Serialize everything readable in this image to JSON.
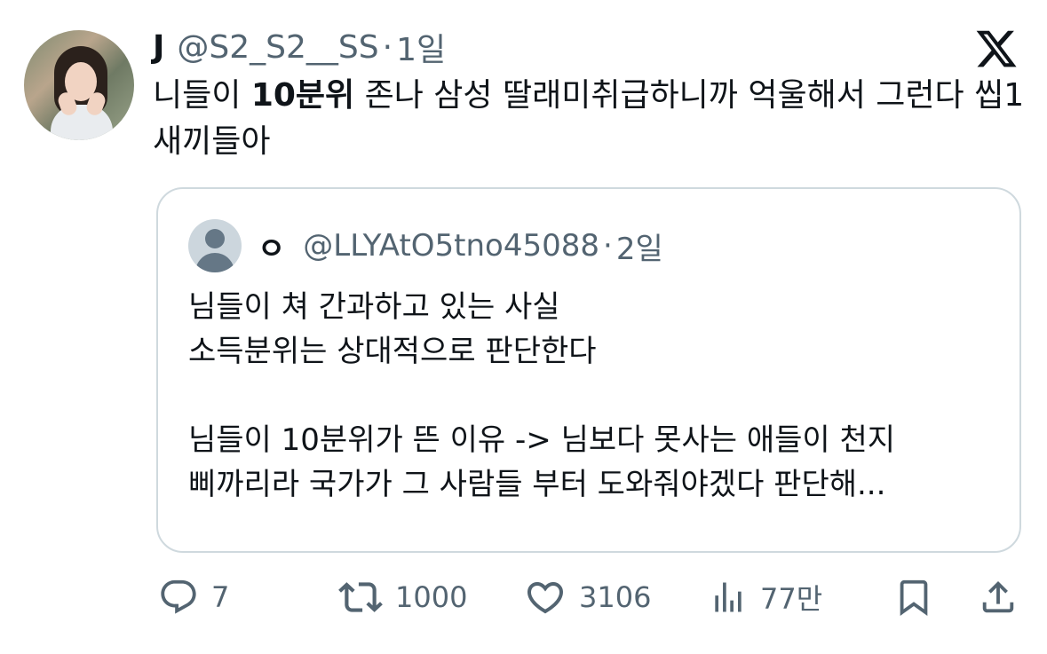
{
  "tweet": {
    "display_name": "J",
    "handle": "@S2_S2__SS",
    "separator": "·",
    "time": "1일",
    "text_part1": "니들이 ",
    "text_bold": "10분위",
    "text_part2": " 존나 삼성 딸래미취급하니까 억울해서 그런다 씹1새끼들아"
  },
  "quote": {
    "display_name": "ㅇ",
    "handle": "@LLYAtO5tno45088",
    "separator": "·",
    "time": "2일",
    "lines": [
      "님들이 쳐 간과하고 있는 사실",
      "소득분위는 상대적으로 판단한다",
      "",
      "님들이 10분위가 뜬 이유 -> 님보다 못사는 애들이 천지",
      "삐까리라 국가가 그 사람들 부터 도와줘야겠다 판단해..."
    ]
  },
  "actions": {
    "reply_count": "7",
    "retweet_count": "1000",
    "like_count": "3106",
    "views_count": "77만"
  },
  "icons": {
    "brand": "x-logo-icon",
    "reply": "reply-icon",
    "retweet": "retweet-icon",
    "like": "heart-icon",
    "views": "views-icon",
    "bookmark": "bookmark-icon",
    "share": "share-icon"
  },
  "colors": {
    "text": "#0f1419",
    "secondary": "#536471",
    "border": "#cfd9de",
    "default_avatar_bg": "#ccd6dd"
  }
}
